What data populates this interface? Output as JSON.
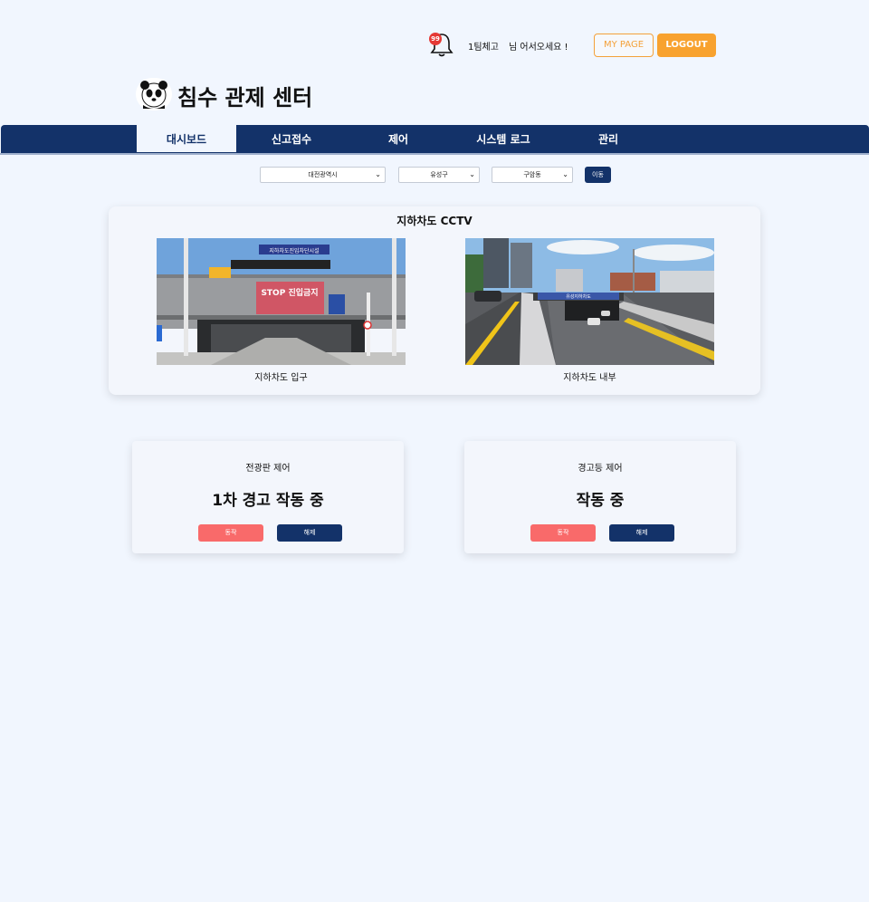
{
  "header": {
    "notification_count": "99",
    "team_name": "1팀체고",
    "greeting": "님 어서오세요 !",
    "mypage_label": "MY PAGE",
    "logout_label": "LOGOUT",
    "title": "침수 관제 센터"
  },
  "nav": {
    "items": [
      {
        "label": "대시보드",
        "active": true
      },
      {
        "label": "신고접수"
      },
      {
        "label": "제어"
      },
      {
        "label": "시스템 로그"
      },
      {
        "label": "관리"
      }
    ]
  },
  "filters": {
    "city": "대전광역시",
    "district": "유성구",
    "neighborhood": "구암동",
    "move_label": "이동"
  },
  "cctv": {
    "title": "지하차도 CCTV",
    "cameras": [
      {
        "caption": "지하차도 입구",
        "sign_top": "지하차도진입차단시설",
        "sign_main": "STOP 진입금지"
      },
      {
        "caption": "지하차도 내부",
        "sign_banner": "유성지하차도"
      }
    ]
  },
  "controls": [
    {
      "label": "전광판 제어",
      "status": "1차 경고 작동 중",
      "on_label": "동작",
      "off_label": "해제"
    },
    {
      "label": "경고등 제어",
      "status": "작동 중",
      "on_label": "동작",
      "off_label": "해제"
    }
  ],
  "colors": {
    "background": "#f1f6fe",
    "nav": "#133269",
    "accent_orange": "#f8a22f",
    "action_red": "#f96a6a"
  }
}
